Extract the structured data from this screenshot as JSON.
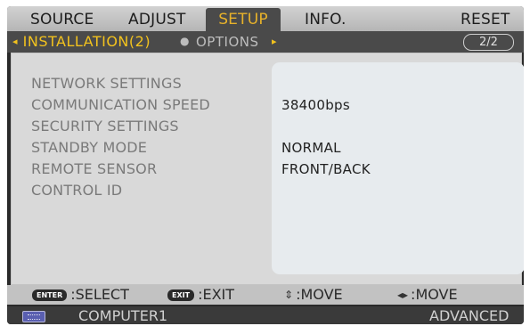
{
  "menu": {
    "tabs": [
      "SOURCE",
      "ADJUST",
      "SETUP",
      "INFO.",
      "RESET"
    ],
    "active_tab": "SETUP"
  },
  "subtabs": {
    "active_prefix": "◂",
    "active_label": "INSTALLATION(2)",
    "separator": "●",
    "other_label": "OPTIONS",
    "other_suffix": "▸",
    "page_indicator": "2/2"
  },
  "settings": [
    {
      "label": "NETWORK SETTINGS",
      "value": ""
    },
    {
      "label": "COMMUNICATION SPEED",
      "value": "38400bps"
    },
    {
      "label": "SECURITY SETTINGS",
      "value": ""
    },
    {
      "label": "STANDBY MODE",
      "value": "NORMAL"
    },
    {
      "label": "REMOTE SENSOR",
      "value": "FRONT/BACK"
    },
    {
      "label": "CONTROL ID",
      "value": ""
    }
  ],
  "help": {
    "enter_key": "ENTER",
    "enter_text": ":SELECT",
    "exit_key": "EXIT",
    "exit_text": ":EXIT",
    "move_vertical_icon": "up-down-arrows-icon",
    "move_vertical_text": ":MOVE",
    "move_horizontal_icon": "left-right-arrows-icon",
    "move_horizontal_text": ":MOVE"
  },
  "status": {
    "source_icon": "computer-port-icon",
    "source": "COMPUTER1",
    "mode": "ADVANCED"
  },
  "colors": {
    "active_tab_text": "#e8b22a",
    "active_subtab_text": "#f2c21e",
    "panel_bg": "#d9d9d9",
    "value_box_bg": "#e7ebee"
  }
}
